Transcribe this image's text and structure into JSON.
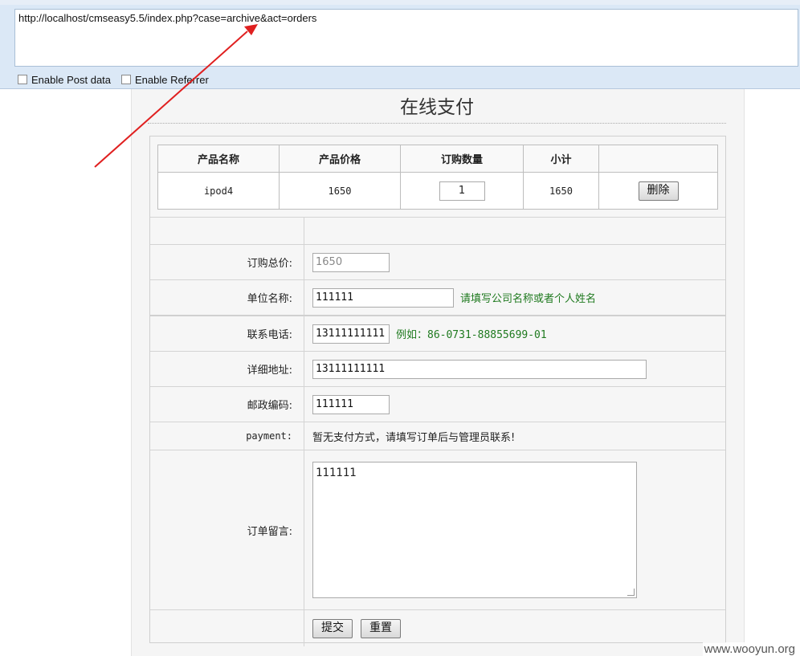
{
  "browser": {
    "url": "http://localhost/cmseasy5.5/index.php?case=archive&act=orders",
    "enable_post_label": "Enable Post data",
    "enable_referrer_label": "Enable Referrer"
  },
  "page": {
    "title": "在线支付"
  },
  "cart": {
    "headers": [
      "产品名称",
      "产品价格",
      "订购数量",
      "小计",
      ""
    ],
    "rows": [
      {
        "name": "ipod4",
        "price": "1650",
        "qty": "1",
        "subtotal": "1650",
        "action": "删除"
      }
    ]
  },
  "form": {
    "total_label": "订购总价:",
    "total_value": "1650",
    "company_label": "单位名称:",
    "company_value": "111111",
    "company_hint": "请填写公司名称或者个人姓名",
    "phone_label": "联系电话:",
    "phone_value": "13111111111",
    "phone_hint": "例如：86-0731-88855699-01",
    "address_label": "详细地址:",
    "address_value": "13111111111",
    "zip_label": "邮政编码:",
    "zip_value": "111111",
    "payment_label": "payment:",
    "payment_value": "暂无支付方式，请填写订单后与管理员联系!",
    "note_label": "订单留言:",
    "note_value": "111111",
    "submit_label": "提交",
    "reset_label": "重置"
  },
  "annotation": {
    "color": "#e02020"
  },
  "watermark": "www.wooyun.org"
}
